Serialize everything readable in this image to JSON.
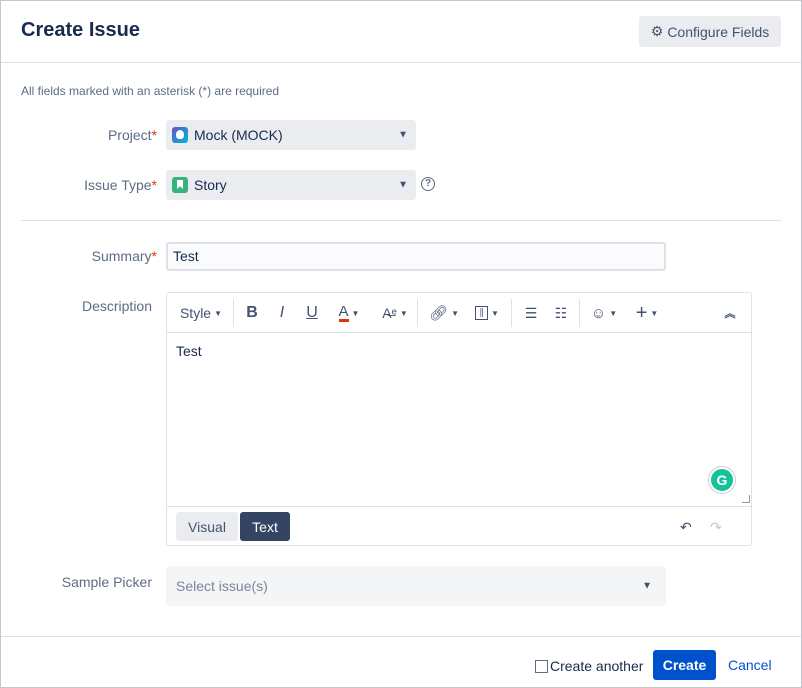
{
  "dialog": {
    "title": "Create Issue",
    "configure_fields_label": "Configure Fields",
    "required_note": "All fields marked with an asterisk (*) are required"
  },
  "form": {
    "project": {
      "label": "Project",
      "value": "Mock (MOCK)"
    },
    "issue_type": {
      "label": "Issue Type",
      "value": "Story"
    },
    "summary": {
      "label": "Summary",
      "value": "Test"
    },
    "description": {
      "label": "Description",
      "content": "Test",
      "toolbar": {
        "style_label": "Style"
      },
      "modes": [
        "Visual",
        "Text"
      ],
      "active_mode": "Text"
    },
    "sample_picker": {
      "label": "Sample Picker",
      "placeholder": "Select issue(s)"
    },
    "required_marker": "*"
  },
  "footer": {
    "create_another_label": "Create another",
    "create_label": "Create",
    "cancel_label": "Cancel"
  },
  "colors": {
    "primary": "#0052cc",
    "required": "#de350b",
    "text_mode_bg": "#344563"
  },
  "icons": [
    "gear-icon",
    "project-avatar-icon",
    "story-icon",
    "help-icon",
    "chevron-down-icon",
    "bold-icon",
    "italic-icon",
    "underline-icon",
    "text-color-icon",
    "text-format-icon",
    "link-icon",
    "attachment-icon",
    "bullet-list-icon",
    "numbered-list-icon",
    "emoji-icon",
    "insert-more-icon",
    "collapse-toolbar-icon",
    "grammarly-icon",
    "undo-icon",
    "redo-icon"
  ]
}
